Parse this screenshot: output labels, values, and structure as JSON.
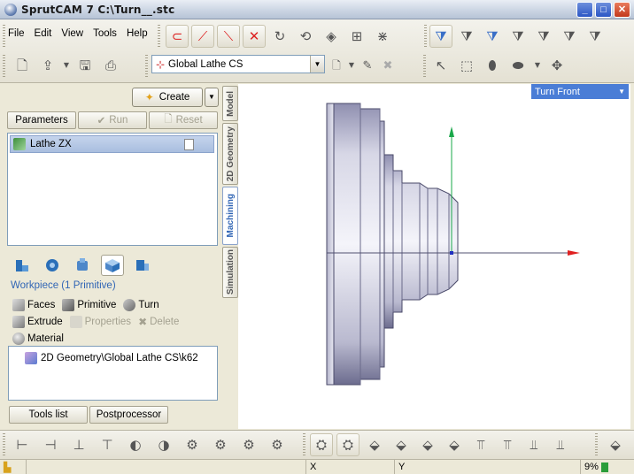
{
  "window": {
    "title": "SprutCAM 7   C:\\Turn__.stc",
    "minimize": "_",
    "maximize": "□",
    "close": "✕"
  },
  "menu": [
    "File",
    "Edit",
    "View",
    "Tools",
    "Help"
  ],
  "toolbar": {
    "coordinate_system": "Global Lathe CS"
  },
  "left_panel": {
    "create_label": "Create",
    "tabs": {
      "parameters": "Parameters",
      "run": "Run",
      "reset": "Reset"
    },
    "operations": [
      {
        "label": "Lathe ZX",
        "selected": true
      }
    ],
    "workpiece_header": "Workpiece  (1 Primitive)",
    "workpiece_actions": {
      "faces": "Faces",
      "primitive": "Primitive",
      "turn": "Turn",
      "extrude": "Extrude",
      "properties": "Properties",
      "delete": "Delete",
      "material": "Material"
    },
    "geometry_items": [
      "2D Geometry\\Global Lathe CS\\k62"
    ],
    "bottom_tabs": {
      "tools_list": "Tools list",
      "postprocessor": "Postprocessor"
    }
  },
  "vertical_tabs": [
    "Model",
    "2D Geometry",
    "Machining",
    "Simulation"
  ],
  "active_vertical_tab": "Machining",
  "viewport": {
    "view_name": "Turn Front"
  },
  "status_bar": {
    "x_label": "X",
    "y_label": "Y",
    "percent": "9%"
  },
  "colors": {
    "accent": "#4a7dd6",
    "selection": "#a9bedf",
    "axis_x": "#e02020",
    "axis_z": "#1aa84a"
  }
}
